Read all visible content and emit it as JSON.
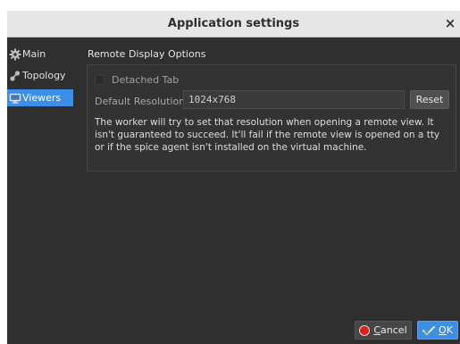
{
  "window": {
    "title": "Application settings",
    "close_glyph": "×"
  },
  "sidebar": {
    "items": [
      {
        "label": "Main",
        "icon": "gear-icon",
        "selected": false
      },
      {
        "label": "Topology",
        "icon": "topology-icon",
        "selected": false
      },
      {
        "label": "Viewers",
        "icon": "monitor-icon",
        "selected": true
      }
    ]
  },
  "viewers": {
    "section_title": "Remote Display Options",
    "detached_tab_label": "Detached Tab",
    "detached_tab_checked": false,
    "default_resolution_label": "Default Resolution",
    "default_resolution_value": "1024x768",
    "reset_label": "Reset",
    "description": "The worker will try to set that resolution when opening a remote view. It isn't guaranteed to succeed. It'll fail if the remote view is opened on a tty or if the spice agent isn't installed on the virtual machine."
  },
  "footer": {
    "cancel_mnemonic": "C",
    "cancel_rest": "ancel",
    "ok_mnemonic": "O",
    "ok_rest": "K"
  },
  "colors": {
    "accent": "#3d8ee6",
    "window_bg": "#2f2f2f",
    "titlebar_bg": "#e6e6e6",
    "cancel_icon": "#e0201b"
  }
}
